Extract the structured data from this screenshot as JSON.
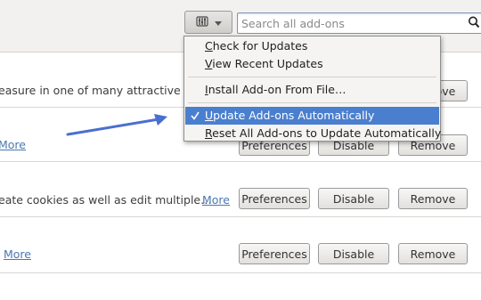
{
  "toolbar": {
    "gear_icon": "tools-gear-icon",
    "dropdown_icon": "dropdown-caret",
    "search_placeholder": "Search all add-ons",
    "search_icon": "magnifier"
  },
  "addons": [
    {
      "description": "easure in one of many attractive layo",
      "more": "",
      "buttons": [
        "",
        "Remove"
      ]
    },
    {
      "description": "",
      "more": "More",
      "buttons": [
        "Preferences",
        "Disable",
        "Remove"
      ]
    },
    {
      "description": "eate cookies as well as edit multiple…",
      "more": "More",
      "buttons": [
        "Preferences",
        "Disable",
        "Remove"
      ]
    },
    {
      "description": "",
      "more": "More",
      "buttons": [
        "Preferences",
        "Disable",
        "Remove"
      ]
    }
  ],
  "menu": {
    "items": [
      {
        "label_u": "C",
        "label_rest": "heck for Updates",
        "checked": false,
        "selected": false
      },
      {
        "label_u": "V",
        "label_rest": "iew Recent Updates",
        "checked": false,
        "selected": false
      },
      {
        "label_u": "I",
        "label_rest": "nstall Add-on From File…",
        "checked": false,
        "selected": false
      },
      {
        "label_u": "U",
        "label_rest": "pdate Add-ons Automatically",
        "checked": true,
        "selected": true
      },
      {
        "label_u": "R",
        "label_rest": "eset All Add-ons to Update Automatically",
        "checked": false,
        "selected": false
      }
    ]
  },
  "colors": {
    "selection": "#4a7fcf",
    "link": "#4a78b0",
    "arrow": "#4a6fd0"
  }
}
